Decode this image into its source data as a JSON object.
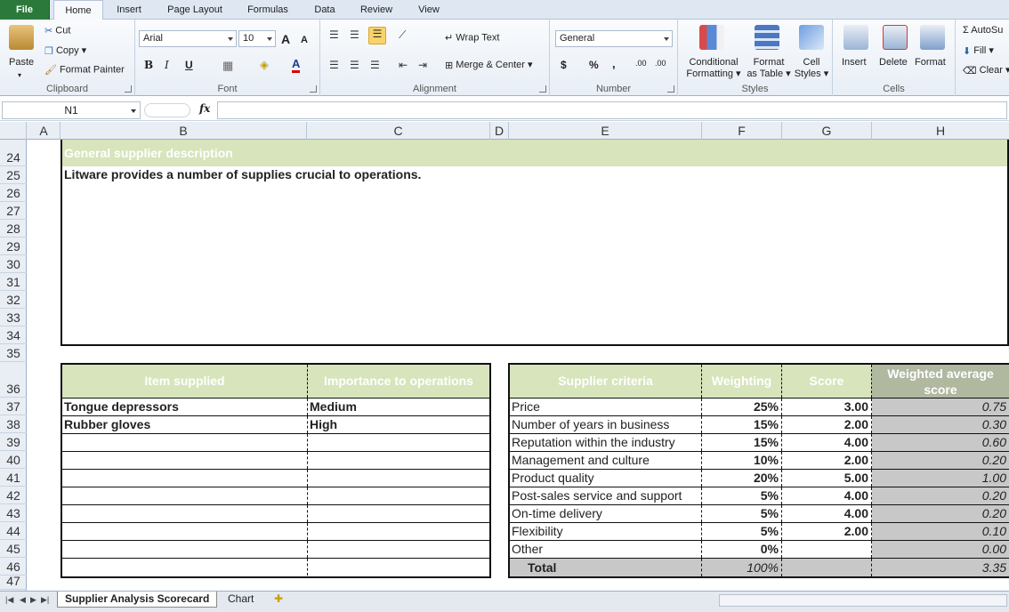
{
  "ribbon": {
    "tabs": [
      "File",
      "Home",
      "Insert",
      "Page Layout",
      "Formulas",
      "Data",
      "Review",
      "View"
    ],
    "clipboard": {
      "paste": "Paste",
      "cut": "Cut",
      "copy": "Copy",
      "format_painter": "Format Painter",
      "label": "Clipboard"
    },
    "font": {
      "name": "Arial",
      "size": "10",
      "label": "Font",
      "bold": "B",
      "italic": "I",
      "underline": "U",
      "grow": "A",
      "shrink": "A",
      "font_color": "A"
    },
    "alignment": {
      "wrap_text": "Wrap Text",
      "merge_center": "Merge & Center",
      "label": "Alignment"
    },
    "number": {
      "format": "General",
      "currency": "$",
      "percent": "%",
      "comma": ",",
      "inc_decimal": ".00",
      "dec_decimal": ".00",
      "label": "Number"
    },
    "styles": {
      "conditional_1": "Conditional",
      "conditional_2": "Formatting",
      "format_table_1": "Format",
      "format_table_2": "as Table",
      "cell_styles_1": "Cell",
      "cell_styles_2": "Styles",
      "label": "Styles"
    },
    "cells": {
      "insert": "Insert",
      "delete": "Delete",
      "format": "Format",
      "label": "Cells"
    },
    "editing": {
      "autosum": "AutoSu",
      "fill": "Fill",
      "clear": "Clear"
    }
  },
  "formula_bar": {
    "name_box": "N1",
    "fx": "fx",
    "value": ""
  },
  "columns": [
    "A",
    "B",
    "C",
    "D",
    "E",
    "F",
    "G",
    "H"
  ],
  "rows": [
    "24",
    "25",
    "26",
    "27",
    "28",
    "29",
    "30",
    "31",
    "32",
    "33",
    "34",
    "35",
    "36",
    "37",
    "38",
    "39",
    "40",
    "41",
    "42",
    "43",
    "44",
    "45",
    "46",
    "47"
  ],
  "description": {
    "header": "General supplier description",
    "text": "Litware provides a number of supplies crucial to operations."
  },
  "items_table": {
    "headers": [
      "Item supplied",
      "Importance to operations"
    ],
    "rows": [
      [
        "Tongue depressors",
        "Medium"
      ],
      [
        "Rubber gloves",
        "High"
      ],
      [
        "",
        ""
      ],
      [
        "",
        ""
      ],
      [
        "",
        ""
      ],
      [
        "",
        ""
      ],
      [
        "",
        ""
      ],
      [
        "",
        ""
      ],
      [
        "",
        ""
      ],
      [
        "",
        ""
      ]
    ]
  },
  "criteria_table": {
    "headers": [
      "Supplier criteria",
      "Weighting",
      "Score",
      "Weighted average score"
    ],
    "rows": [
      [
        "Price",
        "25%",
        "3.00",
        "0.75"
      ],
      [
        "Number of years in business",
        "15%",
        "2.00",
        "0.30"
      ],
      [
        "Reputation within the industry",
        "15%",
        "4.00",
        "0.60"
      ],
      [
        "Management and culture",
        "10%",
        "2.00",
        "0.20"
      ],
      [
        "Product quality",
        "20%",
        "5.00",
        "1.00"
      ],
      [
        "Post-sales service and support",
        "5%",
        "4.00",
        "0.20"
      ],
      [
        "On-time delivery",
        "5%",
        "4.00",
        "0.20"
      ],
      [
        "Flexibility",
        "5%",
        "2.00",
        "0.10"
      ],
      [
        "Other",
        "0%",
        "",
        "0.00"
      ]
    ],
    "total": {
      "label": "Total",
      "weighting": "100%",
      "score": "",
      "weighted": "3.35"
    }
  },
  "sheets": {
    "active": "Supplier Analysis Scorecard",
    "other": "Chart"
  }
}
